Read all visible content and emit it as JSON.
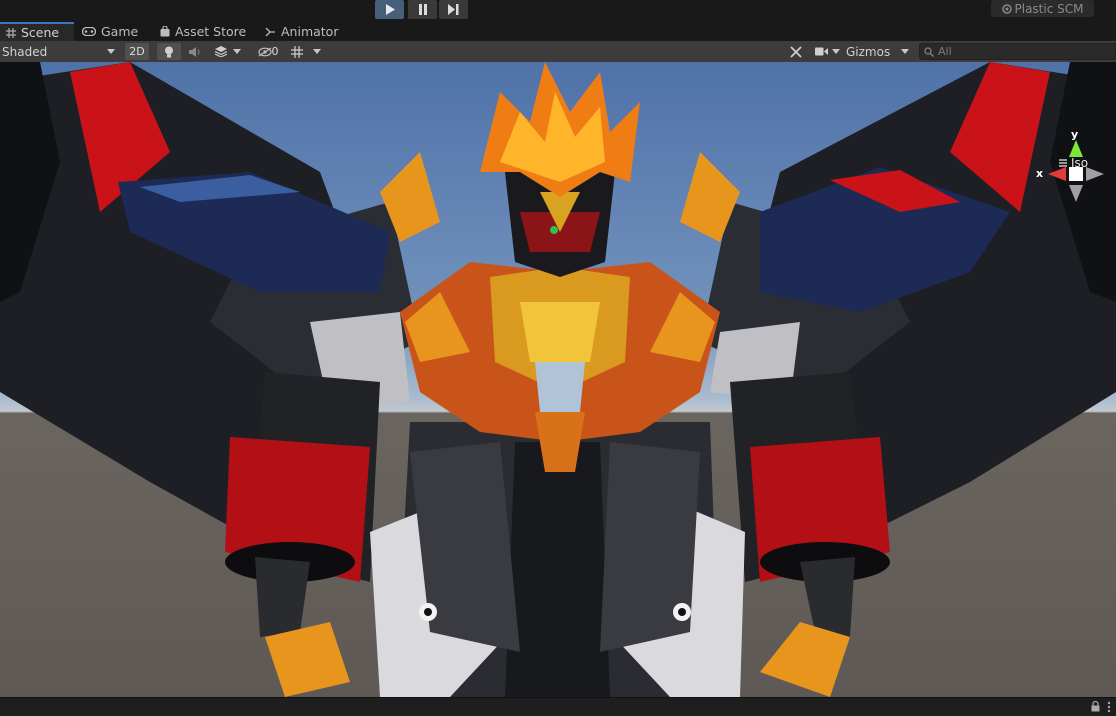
{
  "playbar": {
    "play_icon": "play-icon",
    "pause_icon": "pause-icon",
    "step_icon": "step-icon",
    "plastic_label": "Plastic SCM",
    "plastic_icon": "plastic-scm-icon"
  },
  "tabs": [
    {
      "label": "Scene",
      "icon": "scene-grid-icon",
      "active": true
    },
    {
      "label": "Game",
      "icon": "gamepad-icon",
      "active": false
    },
    {
      "label": "Asset Store",
      "icon": "shopping-bag-icon",
      "active": false
    },
    {
      "label": "Animator",
      "icon": "animator-icon",
      "active": false
    }
  ],
  "toolbar": {
    "shading_mode": "Shaded",
    "toggle_2d": "2D",
    "hidden_count": "0",
    "gizmos_label": "Gizmos",
    "search_placeholder": "All"
  },
  "gizmo": {
    "x_label": "x",
    "y_label": "y",
    "projection_label": "Iso",
    "colors": {
      "x": "#e23b3b",
      "y": "#7ee83a",
      "z": "#a0a0a0"
    }
  },
  "colors": {
    "accent": "#3a79bb",
    "sky_top": "#4f72a8",
    "ground": "#5f5955"
  }
}
